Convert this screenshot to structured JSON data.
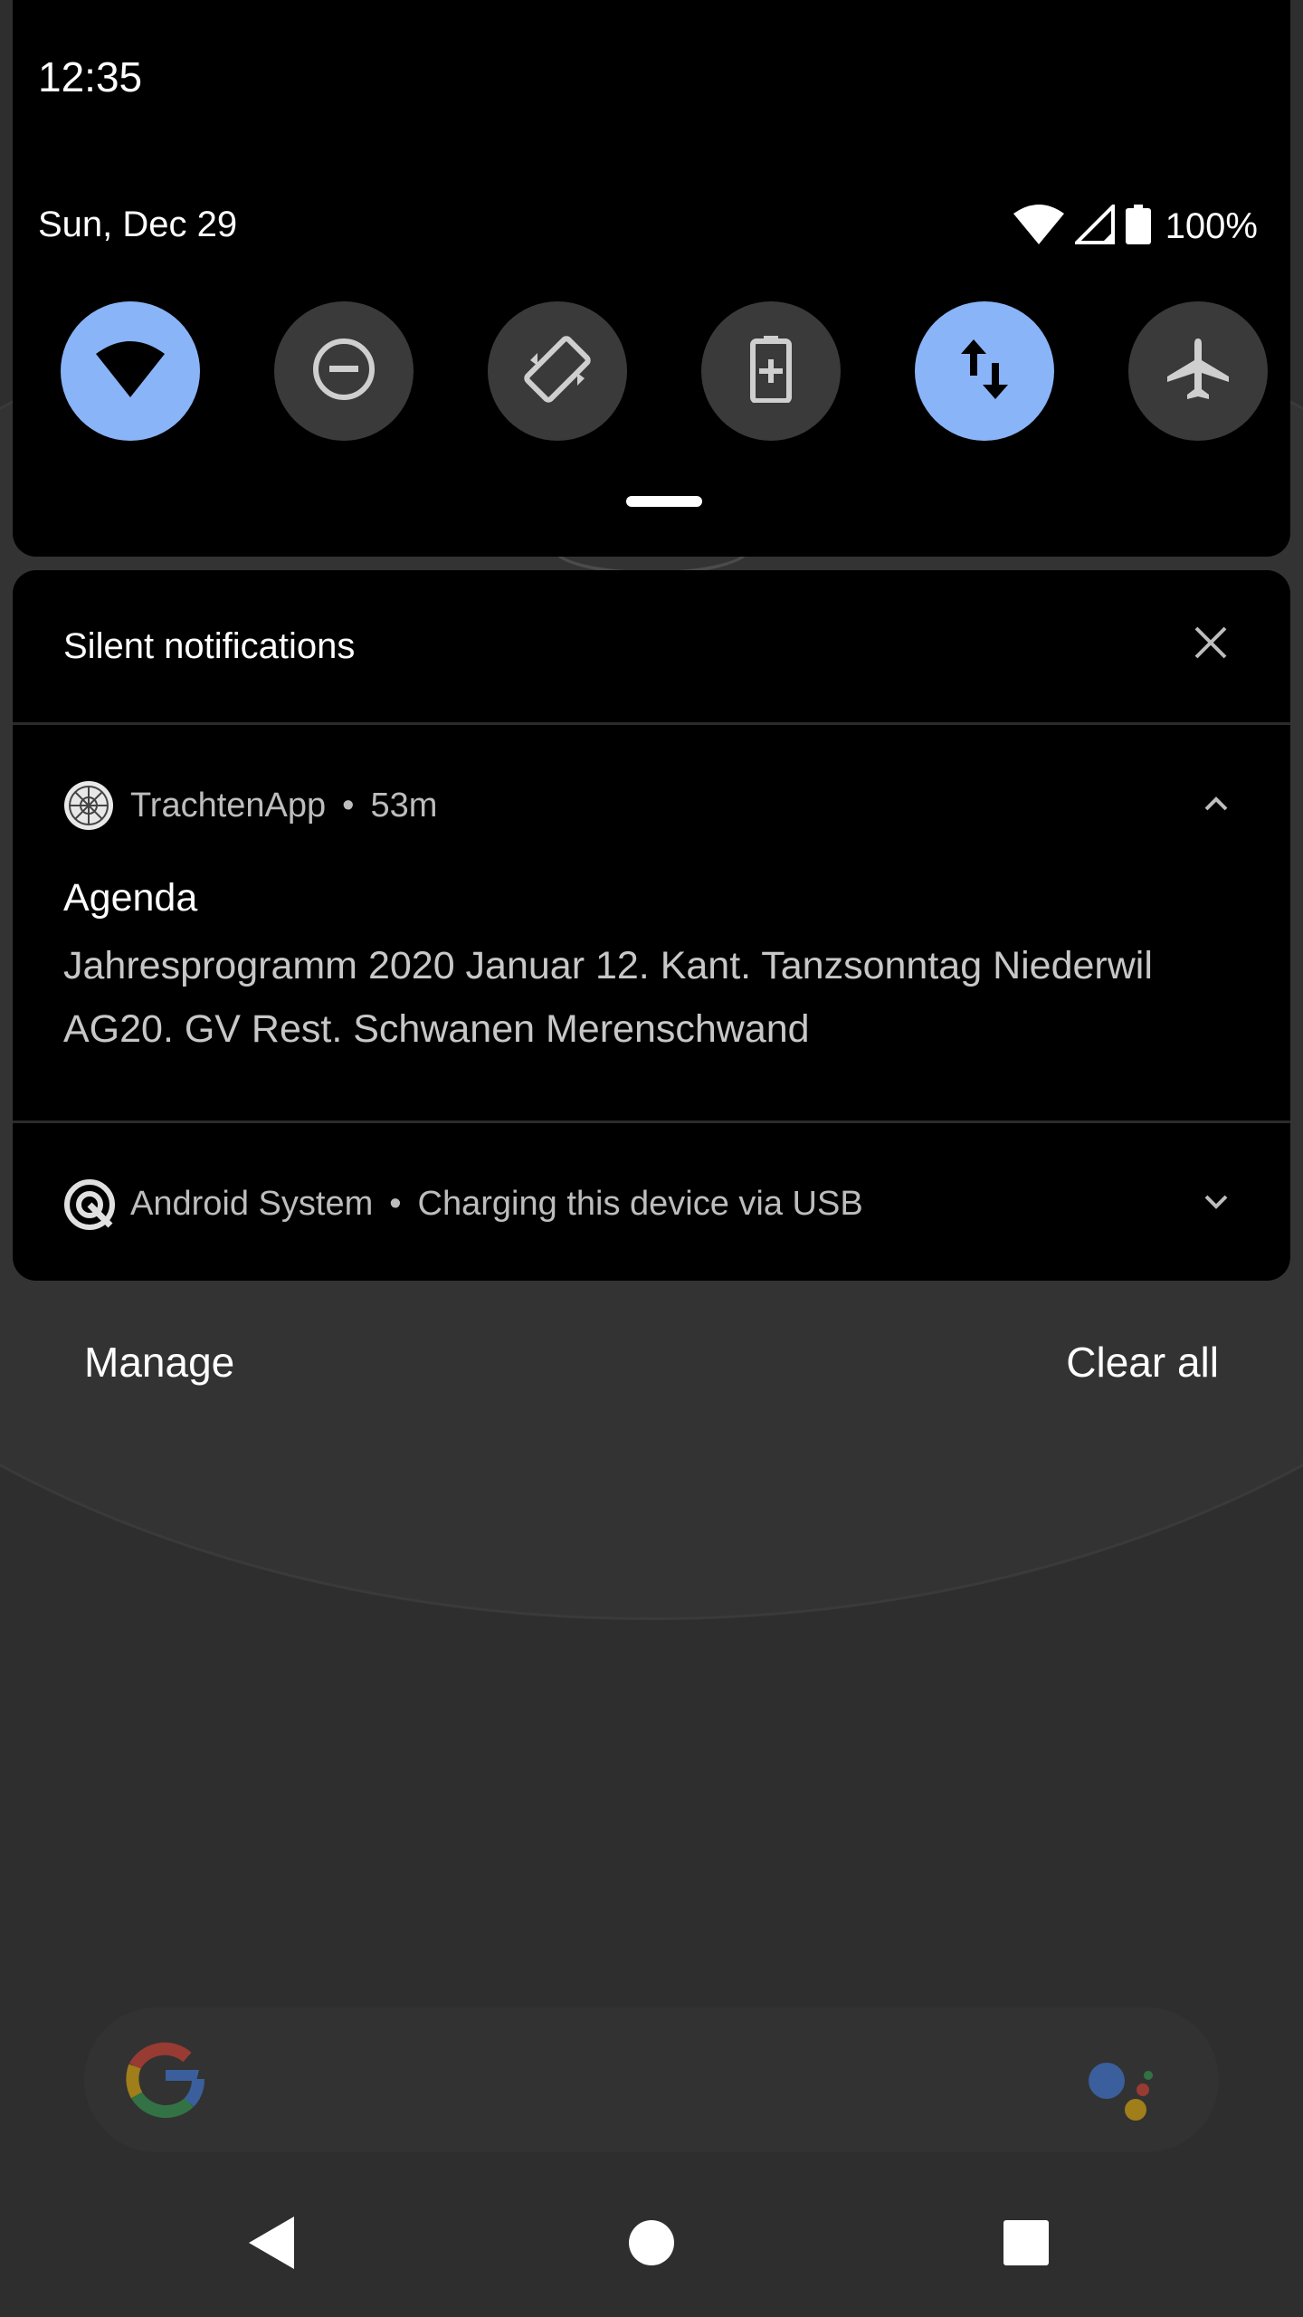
{
  "status_bar": {
    "time": "12:35",
    "date": "Sun, Dec 29",
    "battery_percent": "100%",
    "icons": [
      "wifi-icon",
      "cell-signal-icon",
      "battery-icon"
    ]
  },
  "quick_settings": {
    "tiles": [
      {
        "name": "wifi",
        "icon": "wifi-icon",
        "active": true
      },
      {
        "name": "do-not-disturb",
        "icon": "dnd-icon",
        "active": false
      },
      {
        "name": "auto-rotate",
        "icon": "rotate-icon",
        "active": false
      },
      {
        "name": "battery-saver",
        "icon": "battery-saver-icon",
        "active": false
      },
      {
        "name": "mobile-data",
        "icon": "data-arrows-icon",
        "active": true
      },
      {
        "name": "airplane-mode",
        "icon": "airplane-icon",
        "active": false
      }
    ],
    "accent_color": "#8ab4f8"
  },
  "silent_section": {
    "title": "Silent notifications"
  },
  "notifications": [
    {
      "app": "TrachtenApp",
      "time": "53m",
      "title": "Agenda",
      "body": "Jahresprogramm 2020 Januar 12. Kant. Tanzsonntag Niederwil AG20. GV Rest. Schwanen Merenschwand",
      "expanded": true
    },
    {
      "app": "Android System",
      "summary": "Charging this device via USB",
      "expanded": false
    }
  ],
  "footer": {
    "manage_label": "Manage",
    "clear_all_label": "Clear all"
  },
  "separator": "•"
}
